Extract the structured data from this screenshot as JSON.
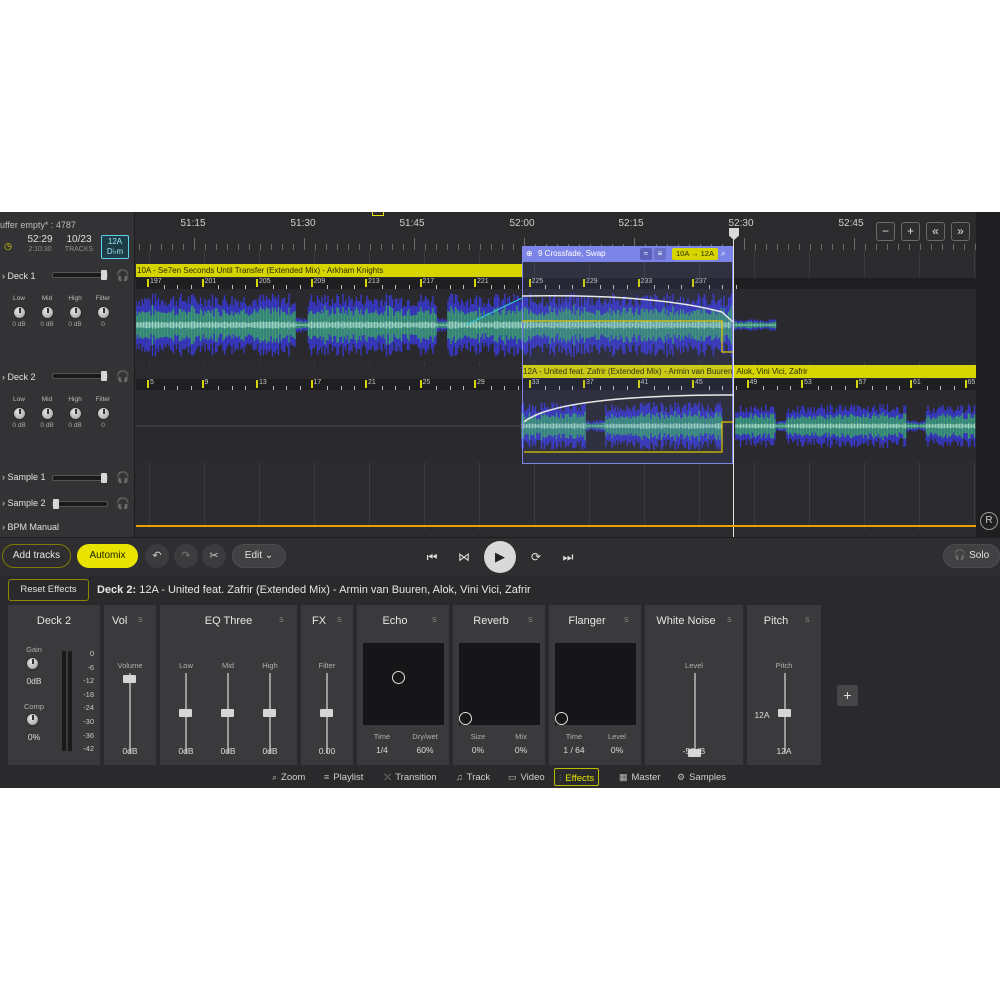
{
  "header": {
    "buffer_text": "uffer empty* : 4787",
    "time_value": "52:29",
    "time_sub": "2:10:30",
    "tracks_value": "10/23",
    "tracks_sub": "TRACKS",
    "key_code": "12A",
    "key_name": "D♭m"
  },
  "decks": [
    {
      "title": "Deck 1",
      "knobs": [
        {
          "label": "Low",
          "value": "0 dB"
        },
        {
          "label": "Mid",
          "value": "0 dB"
        },
        {
          "label": "High",
          "value": "0 dB"
        },
        {
          "label": "Filter",
          "value": "0"
        }
      ]
    },
    {
      "title": "Deck 2",
      "knobs": [
        {
          "label": "Low",
          "value": "0 dB"
        },
        {
          "label": "Mid",
          "value": "0 dB"
        },
        {
          "label": "High",
          "value": "0 dB"
        },
        {
          "label": "Filter",
          "value": "0"
        }
      ]
    }
  ],
  "samples": [
    {
      "title": "Sample 1"
    },
    {
      "title": "Sample 2"
    }
  ],
  "bpm_label": "BPM Manual",
  "timeline": {
    "times": [
      "51:15",
      "51:30",
      "51:45",
      "52:00",
      "52:15",
      "52:30",
      "52:45"
    ],
    "track1_title": "10A - Se7en Seconds Until Transfer (Extended Mix) - Arkham Knights",
    "track1_beats": [
      "197",
      "201",
      "205",
      "209",
      "213",
      "217",
      "221",
      "225",
      "229",
      "233",
      "237"
    ],
    "track2_title": "12A - United feat. Zafrir (Extended Mix) - Armin van Buuren, Alok, Vini Vici, Zafrir",
    "track2_beats": [
      "5",
      "9",
      "13",
      "17",
      "21",
      "25",
      "29",
      "33",
      "37",
      "41",
      "45",
      "49",
      "53",
      "57",
      "61",
      "65"
    ],
    "crossfade_label": "9 Crossfade, Swap",
    "crossfade_keys": "10A → 12A",
    "zoom_buttons": [
      "−",
      "+",
      "«",
      "»"
    ]
  },
  "transport": {
    "add_tracks": "Add tracks",
    "automix": "Automix",
    "edit": "Edit",
    "solo": "Solo"
  },
  "info": {
    "reset_effects": "Reset Effects",
    "deck_label": "Deck 2:",
    "deck_track": "12A - United feat. Zafrir (Extended Mix) - Armin van Buuren, Alok, Vini Vici, Zafrir"
  },
  "fx": {
    "deck": {
      "title": "Deck 2",
      "gain_label": "Gain",
      "gain_value": "0dB",
      "comp_label": "Comp",
      "comp_value": "0%",
      "scale": [
        "0",
        "-6",
        "-12",
        "-18",
        "-24",
        "-30",
        "-36",
        "-42"
      ]
    },
    "vol": {
      "title": "Vol",
      "s": "S",
      "label": "Volume",
      "value": "0dB",
      "level": 0.92
    },
    "eq": {
      "title": "EQ Three",
      "s": "S",
      "bands": [
        {
          "label": "Low",
          "value": "0dB",
          "level": 0.5
        },
        {
          "label": "Mid",
          "value": "0dB",
          "level": 0.5
        },
        {
          "label": "High",
          "value": "0dB",
          "level": 0.5
        }
      ]
    },
    "fxf": {
      "title": "FX",
      "s": "S",
      "label": "Filter",
      "value": "0.00",
      "level": 0.5
    },
    "echo": {
      "title": "Echo",
      "s": "S",
      "params": [
        {
          "label": "Time",
          "value": "1/4"
        },
        {
          "label": "Dry/wet",
          "value": "60%"
        }
      ],
      "pad": [
        0.44,
        0.42
      ]
    },
    "reverb": {
      "title": "Reverb",
      "s": "S",
      "params": [
        {
          "label": "Size",
          "value": "0%"
        },
        {
          "label": "Mix",
          "value": "0%"
        }
      ],
      "pad": [
        0.08,
        0.92
      ]
    },
    "flanger": {
      "title": "Flanger",
      "s": "S",
      "params": [
        {
          "label": "Time",
          "value": "1 / 64"
        },
        {
          "label": "Level",
          "value": "0%"
        }
      ],
      "pad": [
        0.08,
        0.92
      ]
    },
    "noise": {
      "title": "White Noise",
      "s": "S",
      "label": "Level",
      "value": "-50dB",
      "level": 0.0
    },
    "pitch": {
      "title": "Pitch",
      "s": "S",
      "label": "Pitch",
      "key": "12A",
      "value": "12A",
      "level": 0.5
    },
    "add": "+"
  },
  "tabs": [
    {
      "label": "Zoom",
      "icon": "⌕"
    },
    {
      "label": "Playlist",
      "icon": "≡"
    },
    {
      "label": "Transition",
      "icon": "⤫"
    },
    {
      "label": "Track",
      "icon": "♫"
    },
    {
      "label": "Video",
      "icon": "▭"
    },
    {
      "label": "Effects",
      "icon": "⫶",
      "active": true
    },
    {
      "label": "Master",
      "icon": "▦"
    },
    {
      "label": "Samples",
      "icon": "⚙"
    }
  ],
  "colors": {
    "accent": "#e8e400",
    "crossfade": "#7d84e8",
    "wave_blue": "#3a3ad0",
    "wave_green": "#3aa070",
    "bpm_line": "#e8a100"
  }
}
